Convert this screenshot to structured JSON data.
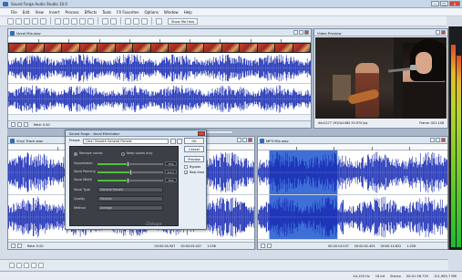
{
  "app": {
    "title": "Sound Forge Audio Studio 10.0"
  },
  "menu": [
    "File",
    "Edit",
    "View",
    "Insert",
    "Process",
    "Effects",
    "Tools",
    "FX Favorites",
    "Options",
    "Window",
    "Help"
  ],
  "toolbar": {
    "show_me_how": "Show Me How"
  },
  "panes": {
    "top": {
      "title": "Vocal Mix.wav",
      "rate": "Rate: 0.00"
    },
    "video": {
      "title": "Video Preview",
      "info_left": "44x1277 1920x1080 29.970 fps",
      "info_right": "Frame: 001.148"
    },
    "left": {
      "title": "Vinyl Track.wav",
      "rate": "Rate: 0.00",
      "time1": "00:00:04.907",
      "time2": "00:00:05.437",
      "zoom": "1:256"
    },
    "right": {
      "title": "MP3 Mix.wav",
      "time1": "00:00:14.537",
      "time2": "00:00:02.403",
      "time3": "00:00:14.622",
      "zoom": "1:256"
    }
  },
  "dialog": {
    "title": "Sound Forge - Vocal Eliminator",
    "preset_label": "Preset:",
    "preset_value": "(Vox) Smooth General Female",
    "buttons": [
      "OK",
      "Cancel",
      "Preview"
    ],
    "checks": [
      {
        "label": "Bypass",
        "checked": false
      },
      {
        "label": "Real-time",
        "checked": true
      }
    ],
    "modes": [
      "Remove vocals",
      "Keep vocals only"
    ],
    "rows": [
      {
        "label": "Suppression",
        "value": "75%",
        "level": 0.46
      },
      {
        "label": "Vocal Panning",
        "value": "0.0 C",
        "level": 0.5
      },
      {
        "label": "Vocal Width",
        "value": "75%",
        "level": 0.46
      }
    ],
    "combos": [
      {
        "label": "Vocal Type",
        "value": "General Female"
      },
      {
        "label": "Quality",
        "value": "Medium"
      },
      {
        "label": "Method",
        "value": "Average"
      }
    ],
    "brand": "iZotope"
  },
  "status": [
    "44,100 Hz",
    "16 bit",
    "Stereo",
    "00:01:36.735",
    "101,985.7 MB"
  ],
  "meter_levels": [
    0.93,
    0.88
  ],
  "colors": {
    "waveform": "#1a2db4",
    "selection": "#3e6fd7"
  }
}
